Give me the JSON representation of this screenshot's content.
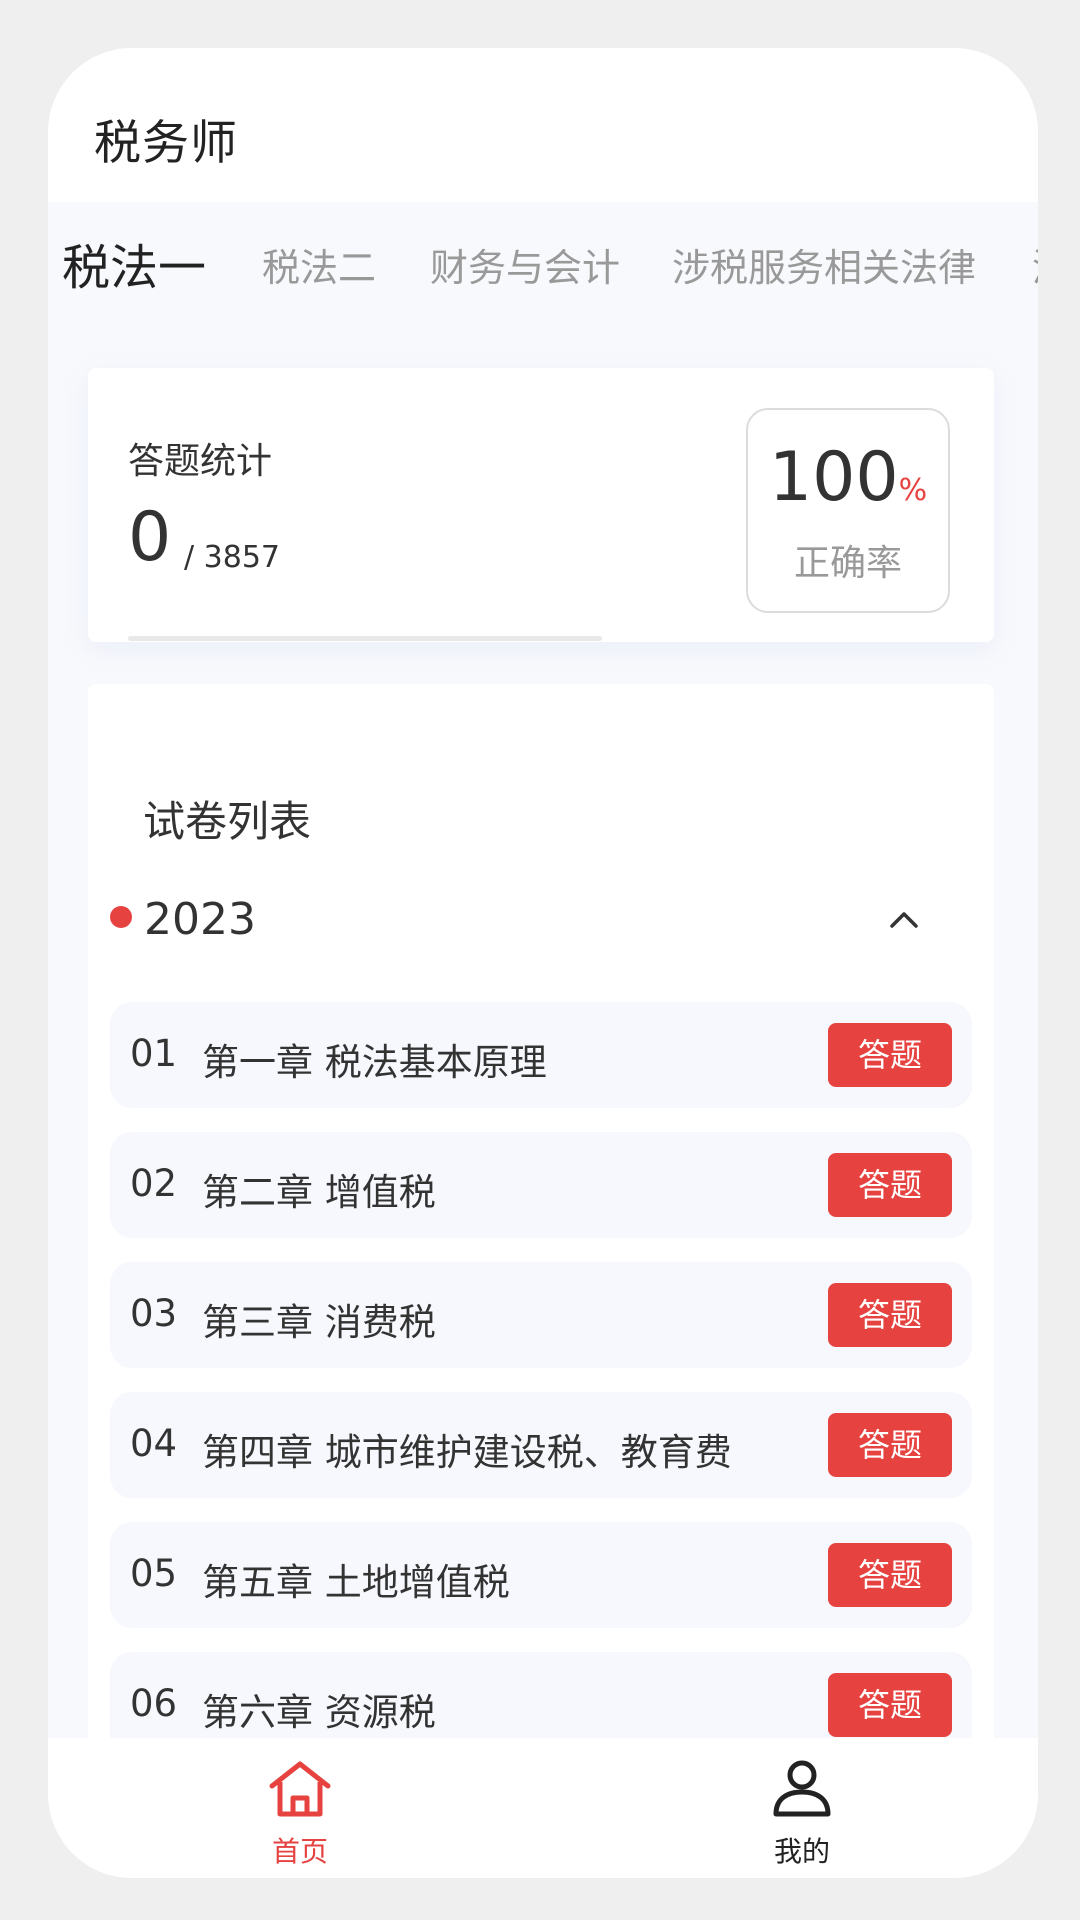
{
  "header": {
    "title": "税务师"
  },
  "tabs": [
    {
      "label": "税法一",
      "active": true
    },
    {
      "label": "税法二",
      "active": false
    },
    {
      "label": "财务与会计",
      "active": false
    },
    {
      "label": "涉税服务相关法律",
      "active": false
    },
    {
      "label": "涉",
      "active": false
    }
  ],
  "stats": {
    "label": "答题统计",
    "answered": "0",
    "total": "/ 3857",
    "progress": 0,
    "accuracy_value": "100",
    "accuracy_unit": "%",
    "accuracy_label": "正确率"
  },
  "papers": {
    "title": "试卷列表",
    "year": "2023",
    "items": [
      {
        "num": "01",
        "title": "第一章 税法基本原理",
        "button": "答题"
      },
      {
        "num": "02",
        "title": "第二章 增值税",
        "button": "答题"
      },
      {
        "num": "03",
        "title": "第三章  消费税",
        "button": "答题"
      },
      {
        "num": "04",
        "title": "第四章  城市维护建设税、教育费",
        "button": "答题"
      },
      {
        "num": "05",
        "title": "第五章  土地增值税",
        "button": "答题"
      },
      {
        "num": "06",
        "title": "第六章  资源税",
        "button": "答题"
      }
    ]
  },
  "bottom_nav": {
    "home": {
      "label": "首页",
      "icon": "home-icon",
      "color": "#e64340"
    },
    "me": {
      "label": "我的",
      "icon": "user-icon",
      "color": "#222222"
    }
  },
  "colors": {
    "accent": "#e64340",
    "background": "#f8f9fd"
  }
}
